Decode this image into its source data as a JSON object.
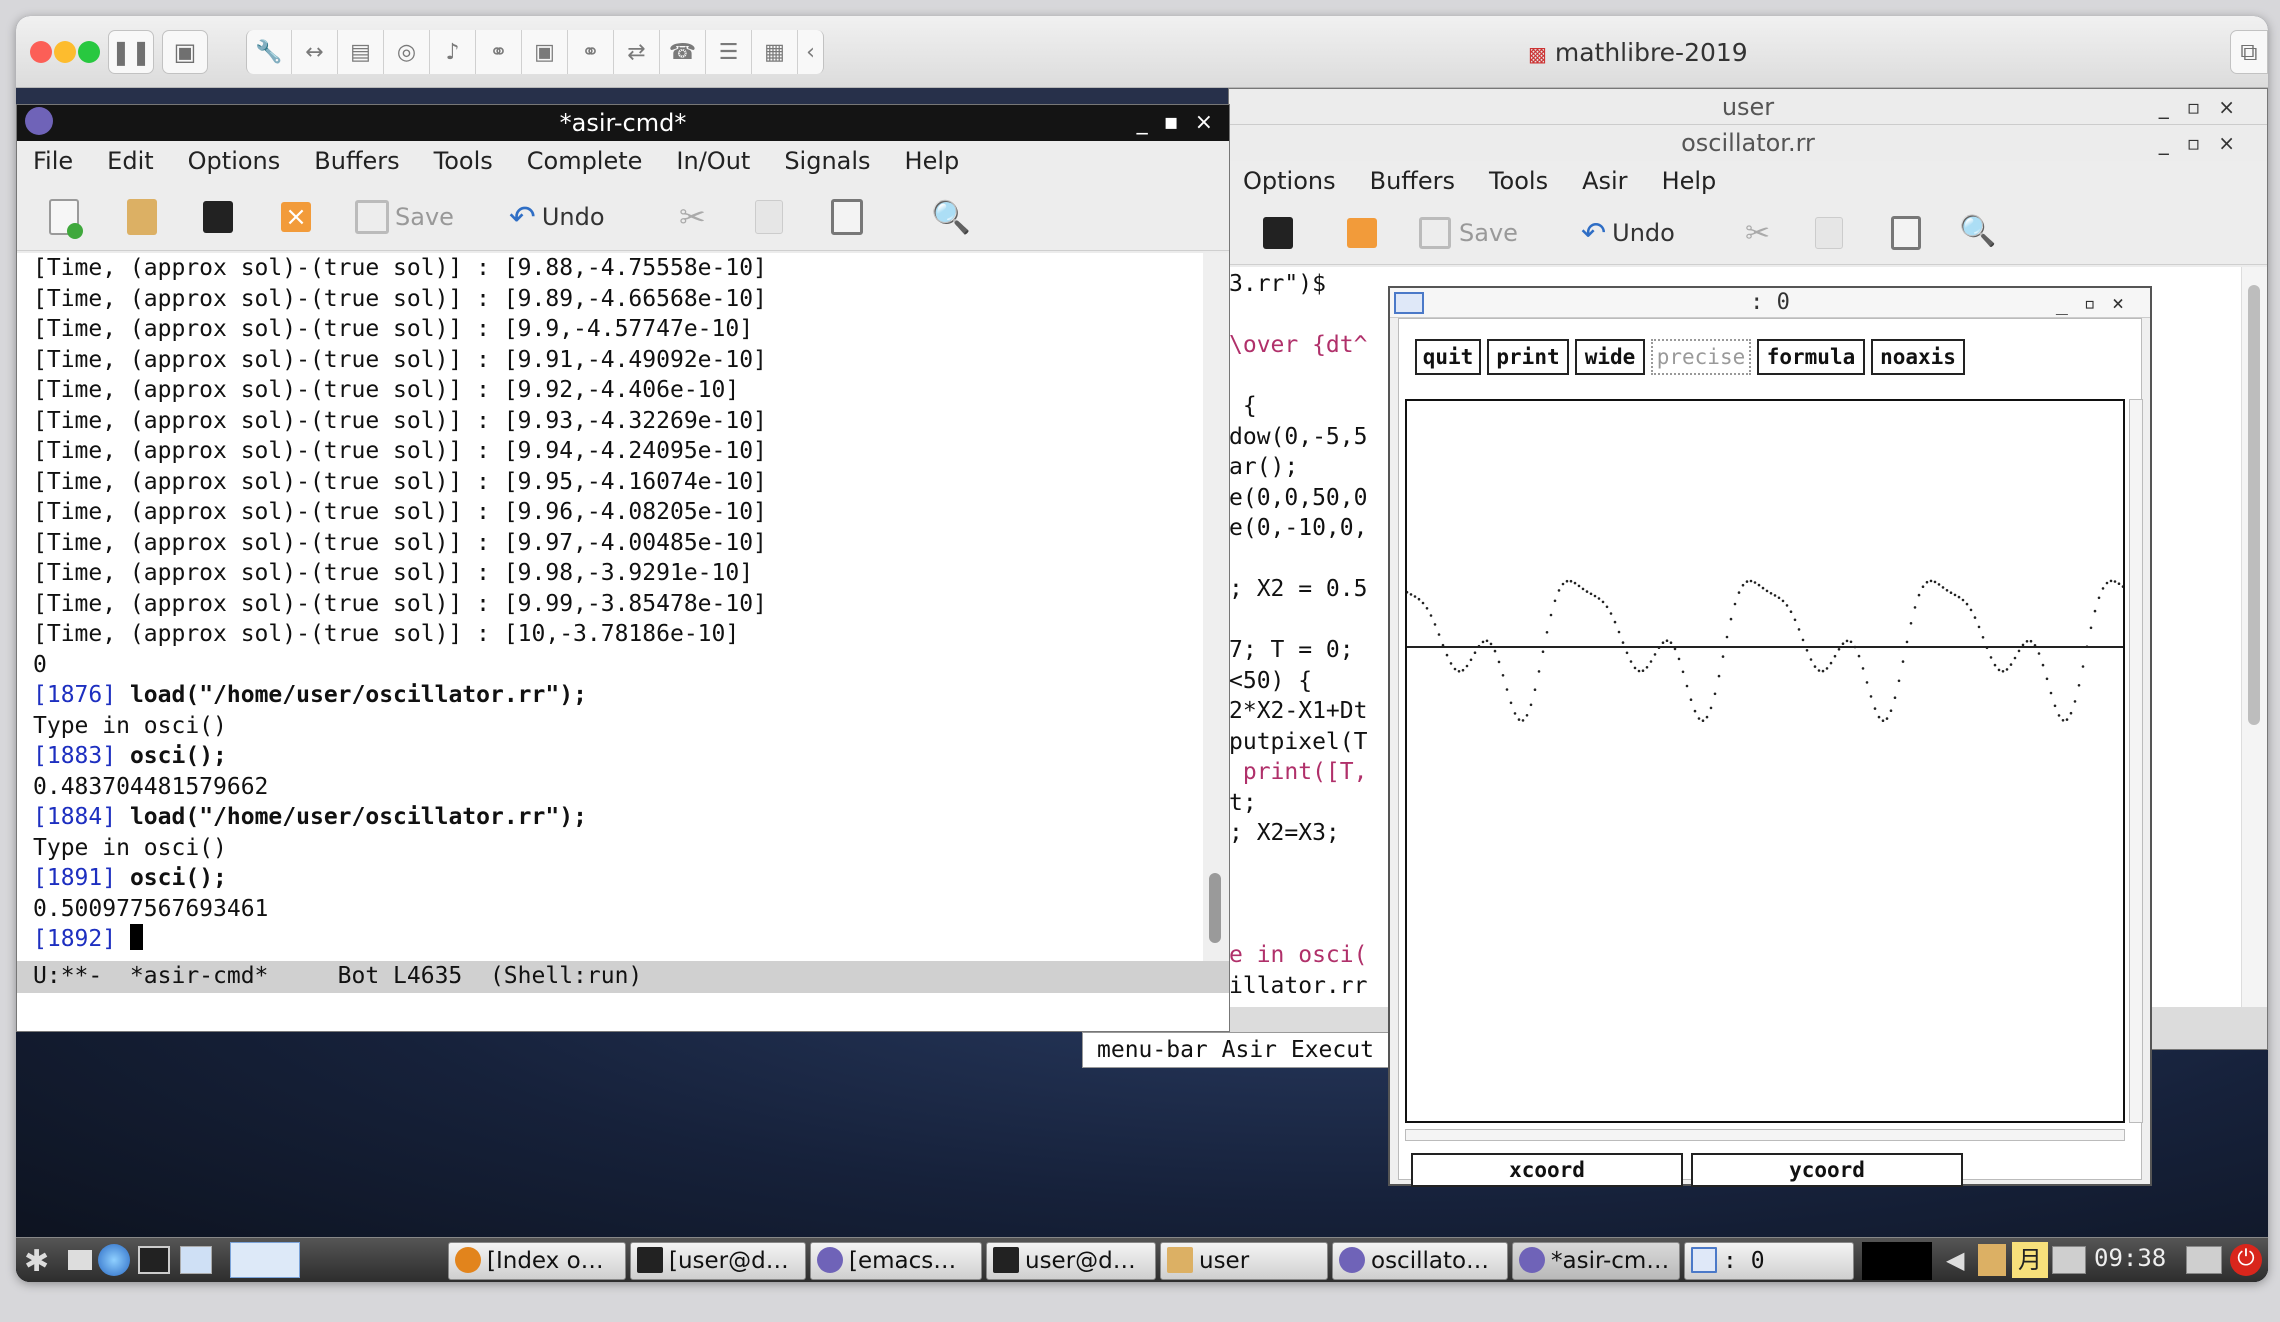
{
  "vm_titlebar": {
    "title": "mathlibre-2019"
  },
  "asir_cmd": {
    "title": "*asir-cmd*",
    "menu": [
      "File",
      "Edit",
      "Options",
      "Buffers",
      "Tools",
      "Complete",
      "In/Out",
      "Signals",
      "Help"
    ],
    "toolbar": {
      "save": "Save",
      "undo": "Undo"
    },
    "lines": [
      {
        "prompt": "",
        "code": "",
        "text": "[Time, (approx sol)-(true sol)] : [9.88,-4.75558e-10]"
      },
      {
        "prompt": "",
        "code": "",
        "text": "[Time, (approx sol)-(true sol)] : [9.89,-4.66568e-10]"
      },
      {
        "prompt": "",
        "code": "",
        "text": "[Time, (approx sol)-(true sol)] : [9.9,-4.57747e-10]"
      },
      {
        "prompt": "",
        "code": "",
        "text": "[Time, (approx sol)-(true sol)] : [9.91,-4.49092e-10]"
      },
      {
        "prompt": "",
        "code": "",
        "text": "[Time, (approx sol)-(true sol)] : [9.92,-4.406e-10]"
      },
      {
        "prompt": "",
        "code": "",
        "text": "[Time, (approx sol)-(true sol)] : [9.93,-4.32269e-10]"
      },
      {
        "prompt": "",
        "code": "",
        "text": "[Time, (approx sol)-(true sol)] : [9.94,-4.24095e-10]"
      },
      {
        "prompt": "",
        "code": "",
        "text": "[Time, (approx sol)-(true sol)] : [9.95,-4.16074e-10]"
      },
      {
        "prompt": "",
        "code": "",
        "text": "[Time, (approx sol)-(true sol)] : [9.96,-4.08205e-10]"
      },
      {
        "prompt": "",
        "code": "",
        "text": "[Time, (approx sol)-(true sol)] : [9.97,-4.00485e-10]"
      },
      {
        "prompt": "",
        "code": "",
        "text": "[Time, (approx sol)-(true sol)] : [9.98,-3.9291e-10]"
      },
      {
        "prompt": "",
        "code": "",
        "text": "[Time, (approx sol)-(true sol)] : [9.99,-3.85478e-10]"
      },
      {
        "prompt": "",
        "code": "",
        "text": "[Time, (approx sol)-(true sol)] : [10,-3.78186e-10]"
      },
      {
        "prompt": "",
        "code": "",
        "text": "0"
      },
      {
        "prompt": "[1876]",
        "code": "load(\"/home/user/oscillator.rr\");",
        "text": ""
      },
      {
        "prompt": "",
        "code": "",
        "text": "Type in osci()"
      },
      {
        "prompt": "[1883]",
        "code": "osci();",
        "text": ""
      },
      {
        "prompt": "",
        "code": "",
        "text": "0.483704481579662"
      },
      {
        "prompt": "[1884]",
        "code": "load(\"/home/user/oscillator.rr\");",
        "text": ""
      },
      {
        "prompt": "",
        "code": "",
        "text": "Type in osci()"
      },
      {
        "prompt": "[1891]",
        "code": "osci();",
        "text": ""
      },
      {
        "prompt": "",
        "code": "",
        "text": "0.500977567693461"
      },
      {
        "prompt": "[1892]",
        "code": "",
        "text": ""
      }
    ],
    "modeline": "U:**-  *asir-cmd*     Bot L4635  (Shell:run)"
  },
  "user_window": {
    "title": "user"
  },
  "oscillator_window": {
    "title": "oscillator.rr",
    "menu": [
      "Options",
      "Buffers",
      "Tools",
      "Asir",
      "Help"
    ],
    "toolbar": {
      "save": "Save",
      "undo": "Undo"
    },
    "lines": [
      {
        "text": "3.rr\")$",
        "cls": ""
      },
      {
        "text": "",
        "cls": ""
      },
      {
        "text": "\\over {dt^",
        "cls": "str"
      },
      {
        "text": "",
        "cls": ""
      },
      {
        "text": " {",
        "cls": ""
      },
      {
        "text": "dow(0,-5,5",
        "cls": ""
      },
      {
        "text": "ar();",
        "cls": ""
      },
      {
        "text": "e(0,0,50,0",
        "cls": ""
      },
      {
        "text": "e(0,-10,0,",
        "cls": ""
      },
      {
        "text": "",
        "cls": ""
      },
      {
        "text": "; X2 = 0.5",
        "cls": ""
      },
      {
        "text": "",
        "cls": ""
      },
      {
        "text": "7; T = 0;",
        "cls": ""
      },
      {
        "text": "<50) {",
        "cls": ""
      },
      {
        "text": "2*X2-X1+Dt",
        "cls": ""
      },
      {
        "text": "putpixel(T",
        "cls": ""
      },
      {
        "text": " print([T,",
        "cls": "str"
      },
      {
        "text": "t;",
        "cls": ""
      },
      {
        "text": "; X2=X3;",
        "cls": ""
      },
      {
        "text": "",
        "cls": ""
      },
      {
        "text": "",
        "cls": ""
      },
      {
        "text": "",
        "cls": ""
      },
      {
        "text": "e in osci(",
        "cls": "str"
      },
      {
        "text": "illator.rr",
        "cls": ""
      }
    ],
    "tooltip": "menu-bar Asir Execut"
  },
  "plot_window": {
    "title": ": 0",
    "buttons": [
      "quit",
      "print",
      "wide",
      "precise",
      "formula",
      "noaxis"
    ],
    "xcoord": "xcoord",
    "ycoord": "ycoord"
  },
  "taskbar": {
    "tasks": [
      "[Index o…",
      "[user@d…",
      "[emacs…",
      "user@d…",
      "user",
      "oscillato…",
      "*asir-cm…",
      ": 0"
    ],
    "ime": "月",
    "clock": "09:38"
  },
  "colors": {
    "prompt": "#1d2fc0",
    "string": "#b0306a",
    "titlebar": "#141414"
  }
}
